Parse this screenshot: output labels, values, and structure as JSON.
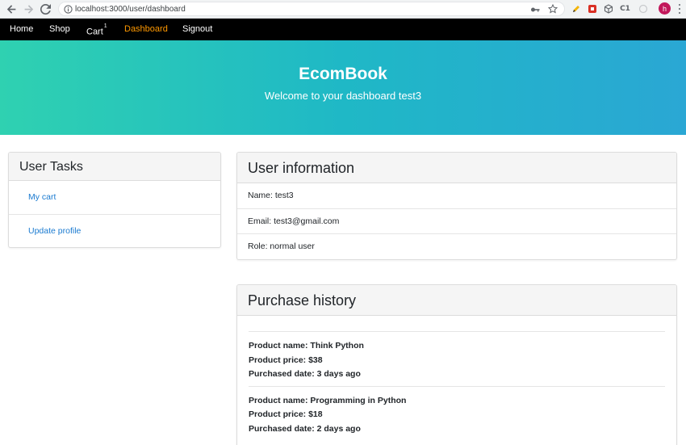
{
  "browser": {
    "url": "localhost:3000/user/dashboard",
    "profile_initial": "h",
    "extension_label": "C1"
  },
  "nav": {
    "items": [
      {
        "label": "Home"
      },
      {
        "label": "Shop"
      },
      {
        "label": "Cart",
        "badge": "1"
      },
      {
        "label": "Dashboard",
        "active": true
      },
      {
        "label": "Signout"
      }
    ],
    "active_color": "#ff9900"
  },
  "hero": {
    "title": "EcomBook",
    "subtitle": "Welcome to your dashboard test3"
  },
  "user_tasks": {
    "title": "User Tasks",
    "links": [
      {
        "label": "My cart"
      },
      {
        "label": "Update profile"
      }
    ]
  },
  "user_info": {
    "title": "User information",
    "rows": [
      {
        "text": "Name: test3"
      },
      {
        "text": "Email: test3@gmail.com"
      },
      {
        "text": "Role: normal user"
      }
    ]
  },
  "purchase_history": {
    "title": "Purchase history",
    "entries": [
      {
        "product_name": "Product name: Think Python",
        "product_price": "Product price: $38",
        "purchased_date": "Purchased date: 3 days ago"
      },
      {
        "product_name": "Product name: Programming in Python",
        "product_price": "Product price: $18",
        "purchased_date": "Purchased date: 2 days ago"
      }
    ]
  }
}
